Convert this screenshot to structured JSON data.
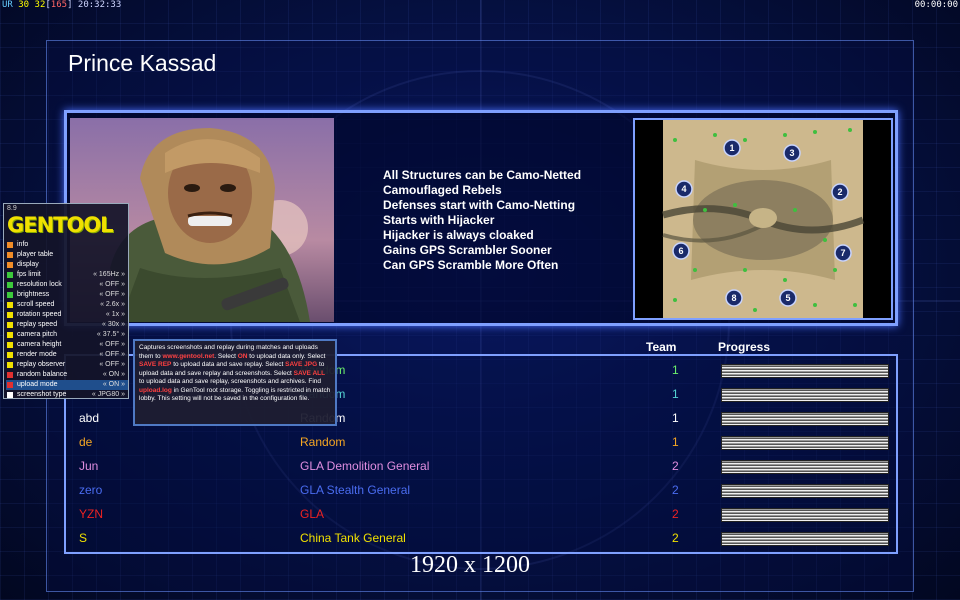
{
  "overlay": {
    "ur_label": "UR",
    "fps": "30",
    "fps_cap": "32",
    "max_fps": "165",
    "clock": "20:32:33",
    "elapsed": "00:00:00"
  },
  "header": {
    "title": "Prince Kassad"
  },
  "features": [
    "All Structures can be Camo-Netted",
    "Camouflaged Rebels",
    "Defenses start with Camo-Netting",
    "Starts with Hijacker",
    "Hijacker is always cloaked",
    "Gains GPS Scrambler Sooner",
    "Can GPS Scramble More Often"
  ],
  "map": {
    "start_positions": [
      "1",
      "2",
      "3",
      "4",
      "5",
      "6",
      "7",
      "8"
    ]
  },
  "columns": {
    "team": "Team",
    "progress": "Progress"
  },
  "players": [
    {
      "name": "",
      "faction": "Random",
      "team": "1",
      "color": "#6cf06c",
      "progress": 1
    },
    {
      "name": "",
      "faction": "Random",
      "team": "1",
      "color": "#55d4d4",
      "progress": 1
    },
    {
      "name": "abd",
      "faction": "Random",
      "team": "1",
      "color": "#ffffff",
      "progress": 1
    },
    {
      "name": "de",
      "faction": "Random",
      "team": "1",
      "color": "#f5a623",
      "progress": 1
    },
    {
      "name": "Jun",
      "faction": "GLA Demolition General",
      "team": "2",
      "color": "#e08ee0",
      "progress": 1
    },
    {
      "name": "zero",
      "faction": "GLA Stealth General",
      "team": "2",
      "color": "#4a6cf0",
      "progress": 1
    },
    {
      "name": "YZN",
      "faction": "GLA",
      "team": "2",
      "color": "#ee2222",
      "progress": 1
    },
    {
      "name": "S",
      "faction": "China Tank General",
      "team": "2",
      "color": "#f0e000",
      "progress": 1
    }
  ],
  "resolution": "1920 x 1200",
  "gentool": {
    "version": "8.9",
    "logo": "GENTOOL",
    "items": [
      {
        "label": "info",
        "value": "",
        "color": "#f08c28"
      },
      {
        "label": "player table",
        "value": "",
        "color": "#f08c28"
      },
      {
        "label": "display",
        "value": "",
        "color": "#f08c28"
      },
      {
        "label": "fps limit",
        "value": "« 165Hz »",
        "color": "#3cc83c"
      },
      {
        "label": "resolution lock",
        "value": "« OFF »",
        "color": "#3cc83c"
      },
      {
        "label": "brightness",
        "value": "« OFF »",
        "color": "#3cc83c"
      },
      {
        "label": "scroll speed",
        "value": "« 2.6x »",
        "color": "#f0e000"
      },
      {
        "label": "rotation speed",
        "value": "« 1x »",
        "color": "#f0e000"
      },
      {
        "label": "replay speed",
        "value": "« 30x »",
        "color": "#f0e000"
      },
      {
        "label": "camera pitch",
        "value": "« 37.5° »",
        "color": "#f0e000"
      },
      {
        "label": "camera height",
        "value": "« OFF »",
        "color": "#f0e000"
      },
      {
        "label": "render mode",
        "value": "« OFF »",
        "color": "#f0e000"
      },
      {
        "label": "replay observer",
        "value": "« OFF »",
        "color": "#f0e000"
      },
      {
        "label": "random balance",
        "value": "« ON »",
        "color": "#e03030"
      },
      {
        "label": "upload mode",
        "value": "« ON »",
        "color": "#e03030"
      },
      {
        "label": "screenshot type",
        "value": "« JPG80 »",
        "color": "#ffffff"
      }
    ],
    "tooltip": {
      "t1": "Captures screenshots and replay during matches and uploads them to ",
      "site": "www.gentool.net",
      "t2": ". Select ",
      "on": "ON",
      "t3": " to upload data only. Select ",
      "save_rep": "SAVE REP",
      "t4": " to upload data and save replay. Select ",
      "save_jpg": "SAVE JPG",
      "t5": " to upload data and save replay and screenshots. Select ",
      "save_all": "SAVE ALL",
      "t6": " to upload data and save replay, screenshots and archives. Find ",
      "log": "upload.log",
      "t7": " in GenTool root storage. Toggling is restricted in match lobby. This setting will not be saved in the configuration file."
    }
  }
}
